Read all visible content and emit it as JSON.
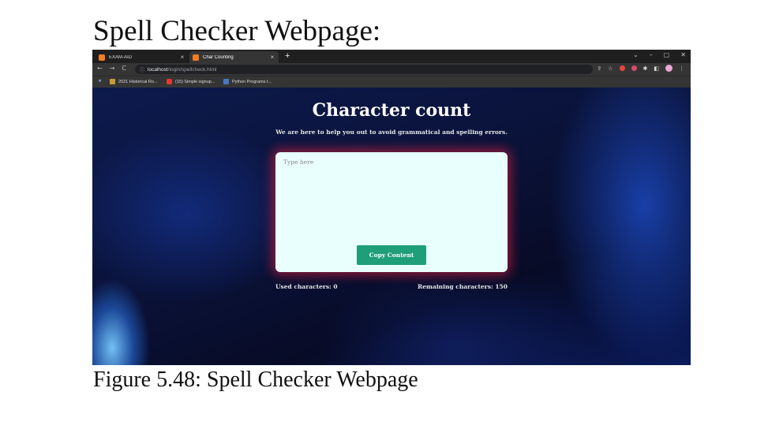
{
  "document": {
    "heading": "Spell Checker Webpage:",
    "caption": "Figure 5.48: Spell Checker Webpage"
  },
  "browser": {
    "tabs": [
      {
        "label": "EXAM-AID",
        "close": "×",
        "active": false
      },
      {
        "label": "Char Counting",
        "close": "×",
        "active": true
      }
    ],
    "new_tab": "+",
    "window_controls": [
      "⌄",
      "–",
      "▢",
      "✕"
    ],
    "nav": {
      "back": "←",
      "forward": "→",
      "reload": "C",
      "info": "ⓘ"
    },
    "url": {
      "host": "localhost",
      "path": "/login/spellcheck.html"
    },
    "bookmarks": [
      {
        "label": "2021 Historical Ro...",
        "icon": "document-icon",
        "color": "#c79a3a"
      },
      {
        "label": "(15) Simple signup...",
        "icon": "youtube-icon",
        "color": "#e53935"
      },
      {
        "label": "Python Programs t...",
        "icon": "python-icon",
        "color": "#4a78c7"
      }
    ]
  },
  "page": {
    "title": "Character count",
    "subtitle": "We are here to help you out to avoid grammatical and spelling errors.",
    "textarea": {
      "placeholder": "Type here",
      "value": ""
    },
    "copy_button": "Copy Content",
    "used_label": "Used characters: 0",
    "remaining_label": "Remaining characters: 150"
  },
  "colors": {
    "button": "#1f9e7a",
    "card": "#e9fffe",
    "card_glow": "#c81e3c",
    "background": "#0a1238"
  }
}
